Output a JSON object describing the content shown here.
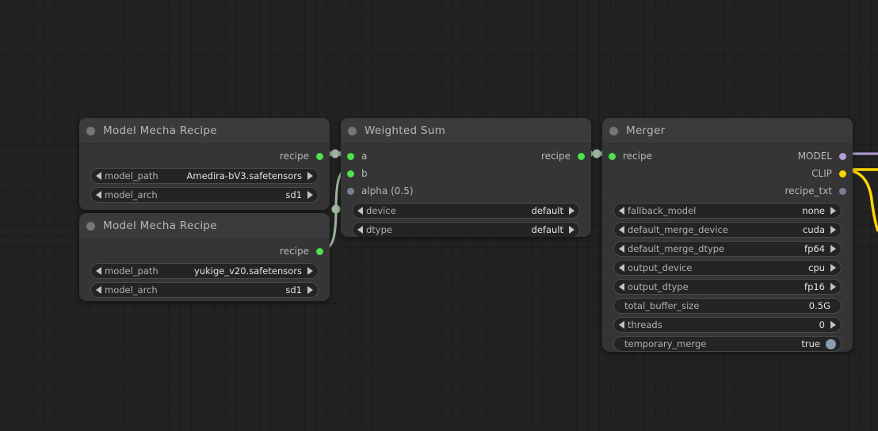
{
  "canvas": {
    "background_color": "#222222",
    "grid_minor_color": "#1b1b1b",
    "grid_major_color": "#2b2b2b"
  },
  "palette": {
    "socket_connected": "#4ee14e",
    "socket_unconnected": "#7b7f95",
    "socket_model": "#b39ddb",
    "socket_clip": "#ffd500",
    "link_recipe": "#9fb89f",
    "link_model": "#b39ddb",
    "link_clip": "#ffd500",
    "node_header": "#3b3b3b",
    "node_body": "#353535",
    "widget_fill": "#242424",
    "widget_border": "#4a4a4a",
    "toggle_on": "#8b9cb0"
  },
  "nodes": [
    {
      "id": "model-mecha-recipe-1",
      "title": "Model Mecha Recipe",
      "outputs": [
        {
          "name": "recipe",
          "socket": "green"
        }
      ],
      "widgets": [
        {
          "label": "model_path",
          "value": "Amedira-bV3.safetensors",
          "type": "combo"
        },
        {
          "label": "model_arch",
          "value": "sd1",
          "type": "combo"
        }
      ]
    },
    {
      "id": "model-mecha-recipe-2",
      "title": "Model Mecha Recipe",
      "outputs": [
        {
          "name": "recipe",
          "socket": "green"
        }
      ],
      "widgets": [
        {
          "label": "model_path",
          "value": "yukige_v20.safetensors",
          "type": "combo"
        },
        {
          "label": "model_arch",
          "value": "sd1",
          "type": "combo"
        }
      ]
    },
    {
      "id": "weighted-sum",
      "title": "Weighted Sum",
      "inputs": [
        {
          "name": "a",
          "socket": "green"
        },
        {
          "name": "b",
          "socket": "green"
        },
        {
          "name": "alpha (0.5)",
          "socket": "gray"
        }
      ],
      "outputs": [
        {
          "name": "recipe",
          "socket": "green"
        }
      ],
      "widgets": [
        {
          "label": "device",
          "value": "default",
          "type": "combo"
        },
        {
          "label": "dtype",
          "value": "default",
          "type": "combo"
        }
      ]
    },
    {
      "id": "merger",
      "title": "Merger",
      "inputs": [
        {
          "name": "recipe",
          "socket": "green"
        }
      ],
      "outputs": [
        {
          "name": "MODEL",
          "socket": "lav"
        },
        {
          "name": "CLIP",
          "socket": "gold"
        },
        {
          "name": "recipe_txt",
          "socket": "gray"
        }
      ],
      "widgets": [
        {
          "label": "fallback_model",
          "value": "none",
          "type": "combo"
        },
        {
          "label": "default_merge_device",
          "value": "cuda",
          "type": "combo"
        },
        {
          "label": "default_merge_dtype",
          "value": "fp64",
          "type": "combo"
        },
        {
          "label": "output_device",
          "value": "cpu",
          "type": "combo"
        },
        {
          "label": "output_dtype",
          "value": "fp16",
          "type": "combo"
        },
        {
          "label": "total_buffer_size",
          "value": "0.5G",
          "type": "text"
        },
        {
          "label": "threads",
          "value": "0",
          "type": "combo"
        },
        {
          "label": "temporary_merge",
          "value": "true",
          "type": "toggle"
        }
      ]
    }
  ]
}
